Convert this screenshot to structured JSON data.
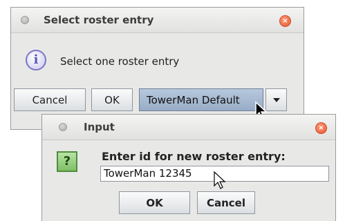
{
  "back_dialog": {
    "title": "Select roster entry",
    "message": "Select one roster entry",
    "cancel_label": "Cancel",
    "ok_label": "OK",
    "combo_selected": "TowerMan Default",
    "info_icon_glyph": "i",
    "close_glyph": "×"
  },
  "input_dialog": {
    "title": "Input",
    "prompt": "Enter id for new roster entry:",
    "field_value": "TowerMan 12345",
    "ok_label": "OK",
    "cancel_label": "Cancel",
    "question_icon_glyph": "?",
    "close_glyph": "×"
  },
  "colors": {
    "close_button": "#e8542c",
    "combo_selected_bg": "#a8bad2",
    "question_icon": "#7fbf66",
    "info_icon": "#7a76c6"
  },
  "icons": [
    "window-menu-dot-icon",
    "close-icon",
    "info-icon",
    "question-icon",
    "chevron-down-icon",
    "mouse-pointer-icon"
  ]
}
